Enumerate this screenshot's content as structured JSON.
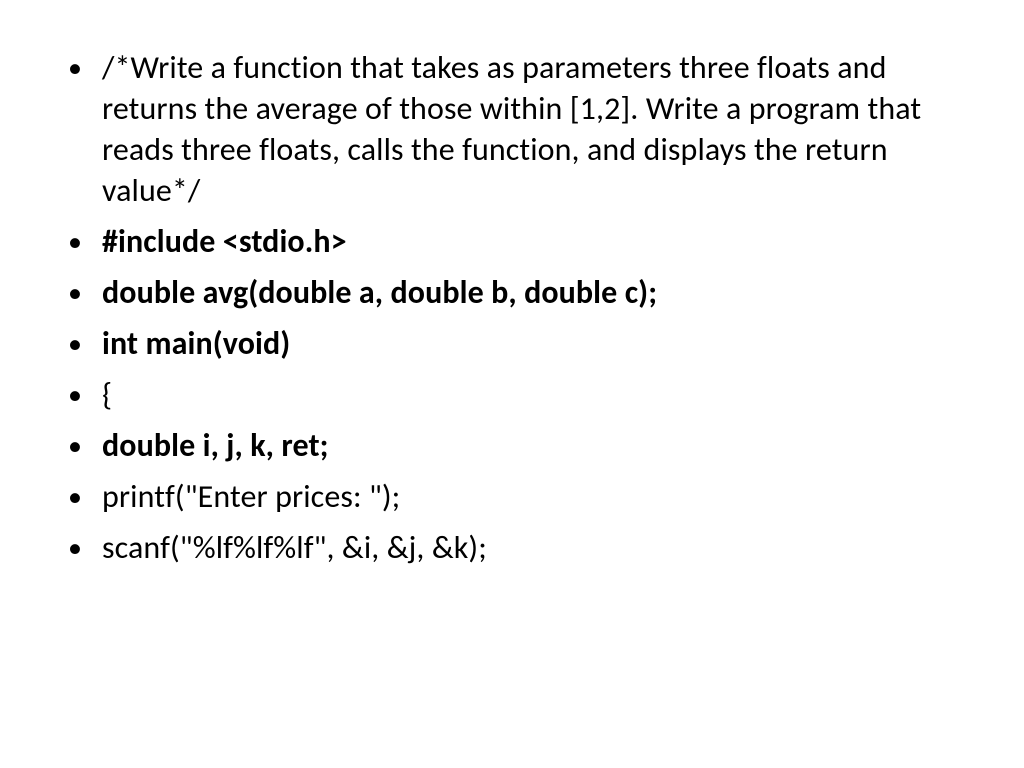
{
  "lines": [
    {
      "text": "/*Write a function that takes as parameters three floats and returns the average of those within [1,2]. Write a program that reads three floats, calls the function, and displays the return value*/",
      "bold": false
    },
    {
      "text": "#include <stdio.h>",
      "bold": true
    },
    {
      "text": "double avg(double a, double b, double c);",
      "bold": true
    },
    {
      "text": "int main(void)",
      "bold": true
    },
    {
      "text": "{",
      "bold": false
    },
    {
      "text": "double i, j, k, ret;",
      "bold": true
    },
    {
      "text": "printf(\"Enter prices: \");",
      "bold": false
    },
    {
      "text": "scanf(\"%lf%lf%lf\", &i, &j, &k);",
      "bold": false
    }
  ]
}
